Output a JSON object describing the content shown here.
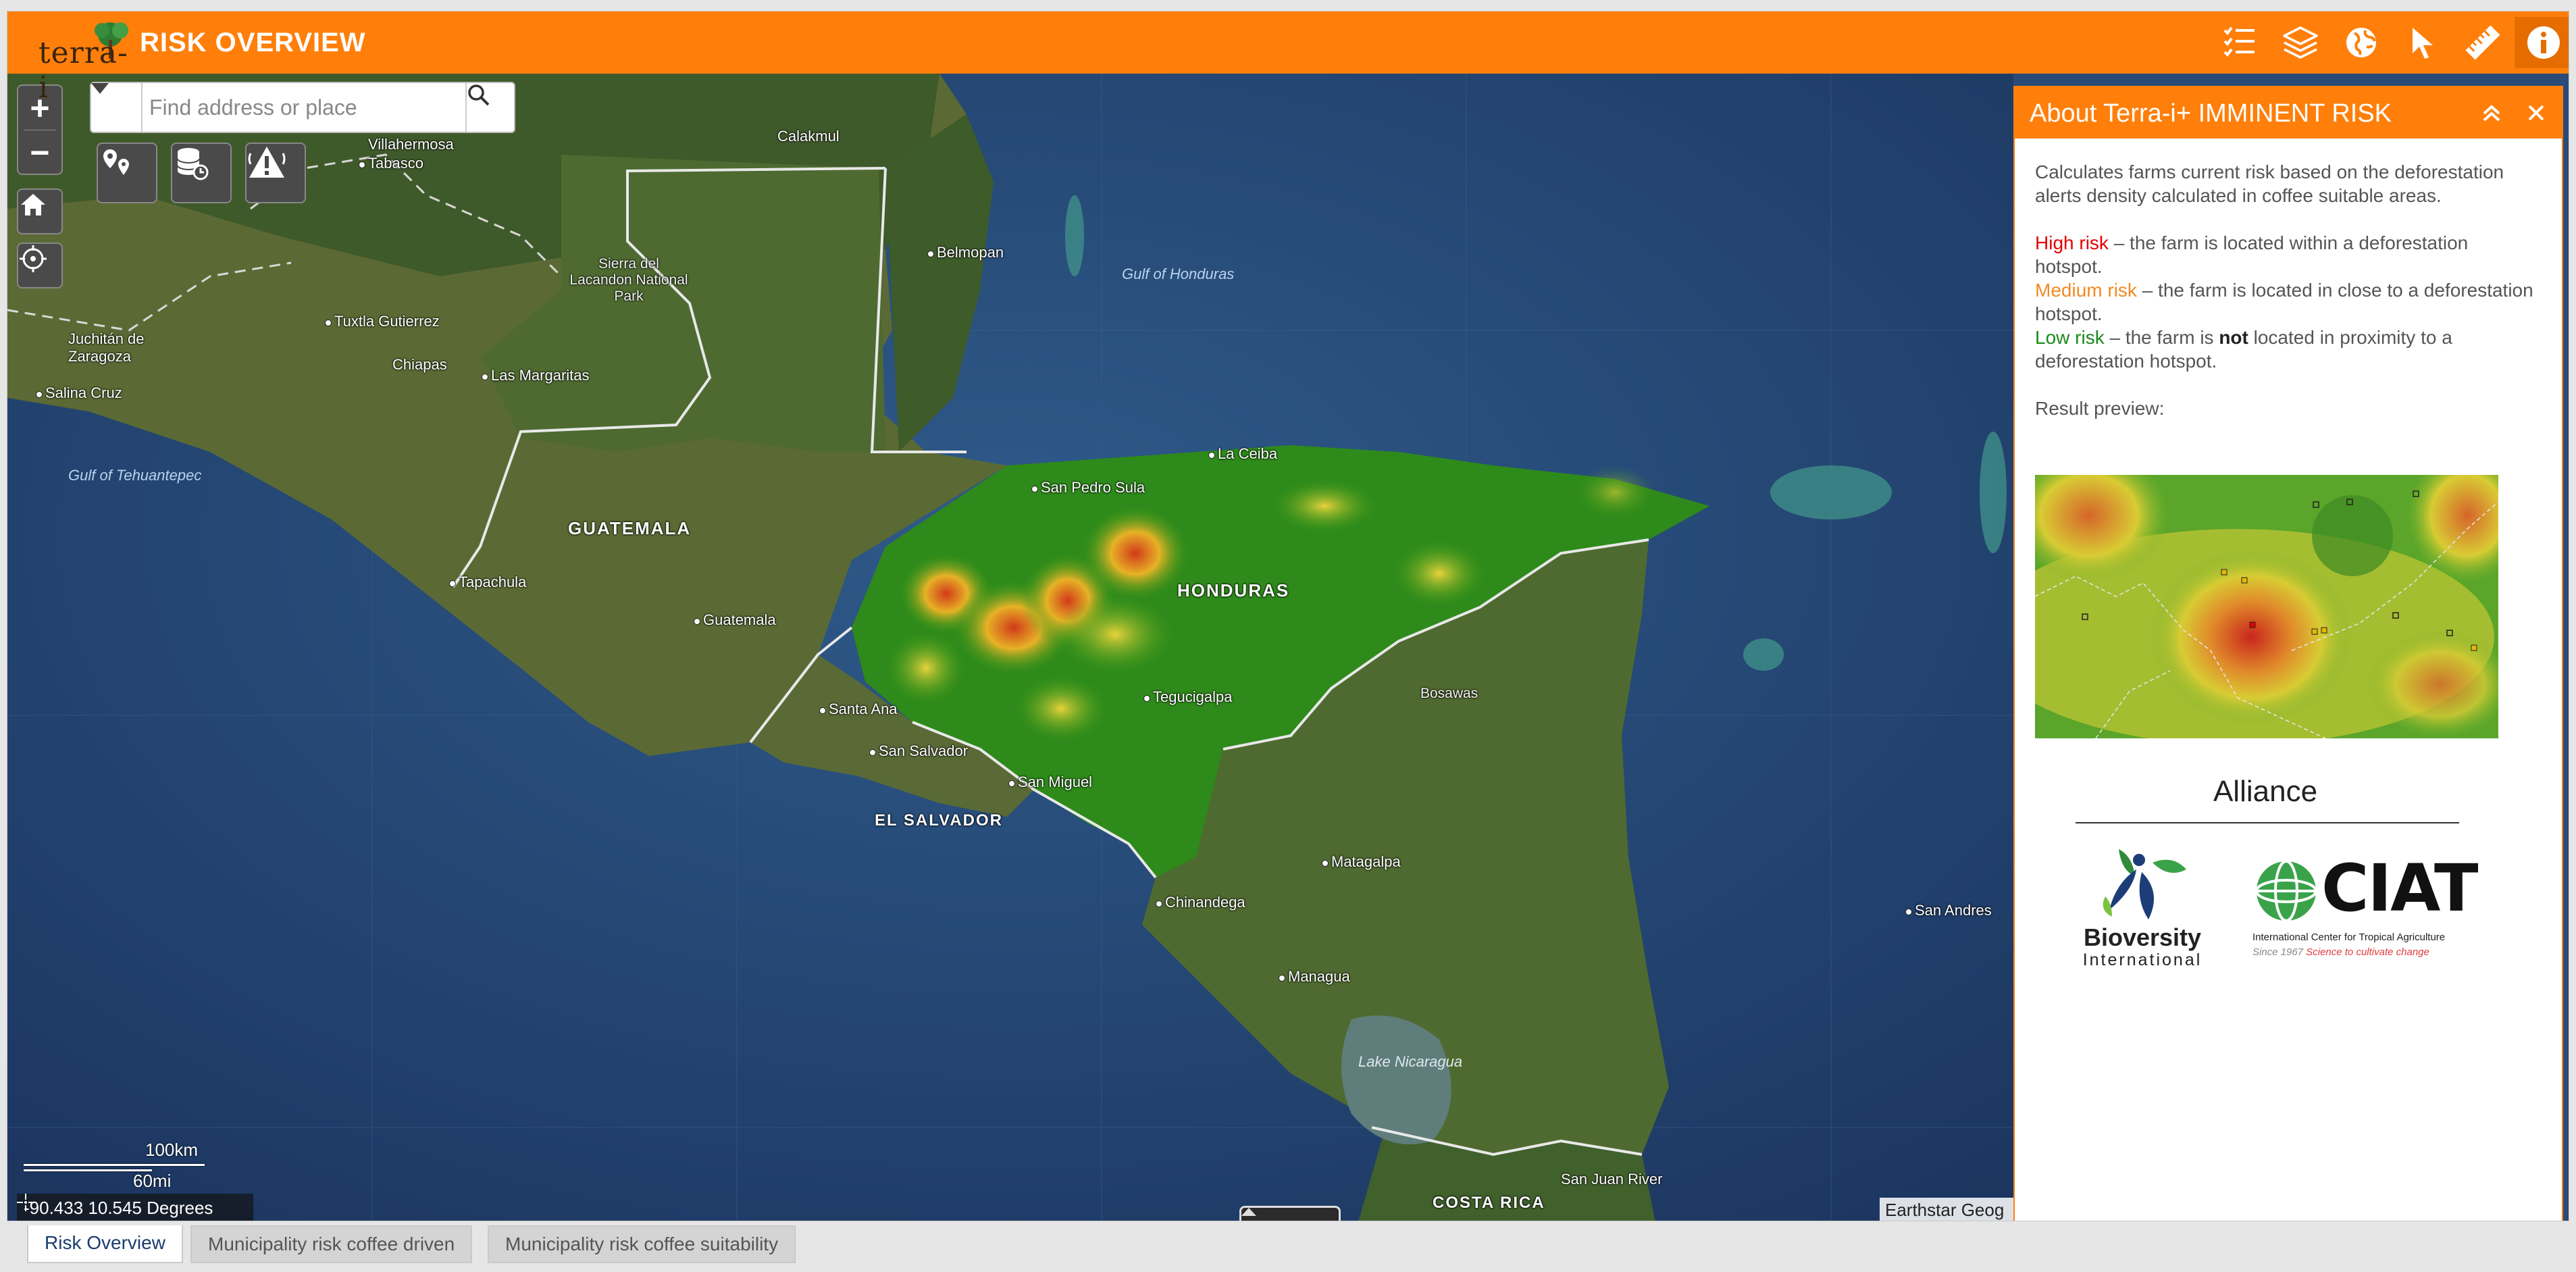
{
  "header": {
    "logo_text": "terra-i",
    "title": "RISK OVERVIEW",
    "buttons": [
      {
        "icon": "list-icon"
      },
      {
        "icon": "layers-icon"
      },
      {
        "icon": "globe-icon"
      },
      {
        "icon": "cursor-icon"
      },
      {
        "icon": "ruler-icon"
      },
      {
        "icon": "info-icon"
      }
    ],
    "accent_color": "#ff7f0a"
  },
  "search": {
    "placeholder": "Find address or place"
  },
  "map": {
    "labels": {
      "calakmul": "Calakmul",
      "villahermosa": "Villahermosa",
      "tabasco": "Tabasco",
      "belmopan": "Belmopan",
      "gulf_honduras": "Gulf of Honduras",
      "sierra_lacandon": "Sierra del Lacandon National Park",
      "tuxtla": "Tuxtla Gutierrez",
      "juchitan": "Juchitán de Zaragoza",
      "chiapas": "Chiapas",
      "las_margaritas": "Las Margaritas",
      "salina_cruz": "Salina Cruz",
      "gulf_tehuantepec": "Gulf of Tehuantepec",
      "la_ceiba": "La Ceiba",
      "san_pedro_sula": "San Pedro Sula",
      "guatemala_country": "GUATEMALA",
      "honduras_country": "HONDURAS",
      "tapachula": "Tapachula",
      "guatemala_city": "Guatemala",
      "tegucigalpa": "Tegucigalpa",
      "bosawas": "Bosawas",
      "santa_ana": "Santa Ana",
      "san_salvador": "San Salvador",
      "san_miguel": "San Miguel",
      "el_salvador_country": "EL SALVADOR",
      "matagalpa": "Matagalpa",
      "chinandega": "Chinandega",
      "san_andres": "San Andres",
      "managua": "Managua",
      "lake_nicaragua": "Lake Nicaragua",
      "san_juan_river": "San Juan River",
      "costa_rica_country": "COSTA RICA"
    },
    "scale_km": "100km",
    "scale_mi": "60mi",
    "coordinates": "-90.433 10.545 Degrees",
    "attribution": "Earthstar Geog"
  },
  "panel": {
    "title": "About Terra-i+ IMMINENT RISK",
    "intro": "Calculates farms current risk based on the deforestation alerts density calculated in coffee suitable areas.",
    "high_label": "High risk",
    "high_text": " – the farm is located within a deforestation hotspot.",
    "medium_label": "Medium risk",
    "medium_text": " – the farm is located in close to a deforestation hotspot.",
    "low_label": "Low risk",
    "low_text_1": " – the farm is ",
    "low_text_not": "not",
    "low_text_2": " located in proximity to a deforestation hotspot.",
    "result_preview": "Result preview:",
    "alliance": "Alliance",
    "bioversity_name": "Bioversity",
    "bioversity_sub": "International",
    "ciat_name": "CIAT",
    "ciat_sub": "International Center for Tropical Agriculture",
    "ciat_since": "Since 1967",
    "ciat_slogan": "Science to cultivate change",
    "colors": {
      "high": "#e60000",
      "medium": "#f08a24",
      "low": "#1a8a1a"
    }
  },
  "tabs": [
    {
      "label": "Risk Overview",
      "active": true
    },
    {
      "label": "Municipality risk coffee driven",
      "active": false
    },
    {
      "label": "Municipality risk coffee suitability",
      "active": false
    }
  ]
}
